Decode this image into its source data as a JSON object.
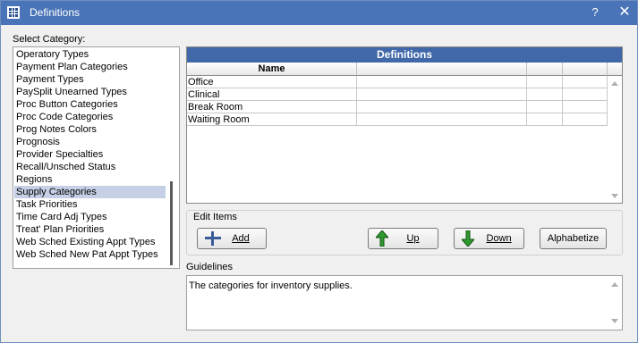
{
  "window": {
    "title": "Definitions",
    "help_glyph": "?",
    "close_glyph": "✕"
  },
  "select_category": {
    "label": "Select Category:",
    "items": [
      "Operatory Types",
      "Payment Plan Categories",
      "Payment Types",
      "PaySplit Unearned Types",
      "Proc Button Categories",
      "Proc Code Categories",
      "Prog Notes Colors",
      "Prognosis",
      "Provider Specialties",
      "Recall/Unsched Status",
      "Regions",
      "Supply Categories",
      "Task Priorities",
      "Time Card Adj Types",
      "Treat' Plan Priorities",
      "Web Sched Existing Appt Types",
      "Web Sched New Pat Appt Types"
    ],
    "selected": "Supply Categories"
  },
  "definitions": {
    "header": "Definitions",
    "columns": [
      "Name",
      "",
      "",
      ""
    ],
    "rows": [
      "Office",
      "Clinical",
      "Break Room",
      "Waiting Room"
    ]
  },
  "edit_items": {
    "label": "Edit Items",
    "add": "Add",
    "up": "Up",
    "down": "Down",
    "alphabetize": "Alphabetize"
  },
  "guidelines": {
    "label": "Guidelines",
    "text": "The categories for inventory supplies."
  },
  "colors": {
    "titlebar": "#4a74b8",
    "header": "#4168a8",
    "selection": "#c5cfe6",
    "arrow_green": "#2e9a2e"
  },
  "icons": {
    "add": "plus-icon",
    "up": "green-up-arrow-icon",
    "down": "green-down-arrow-icon"
  }
}
